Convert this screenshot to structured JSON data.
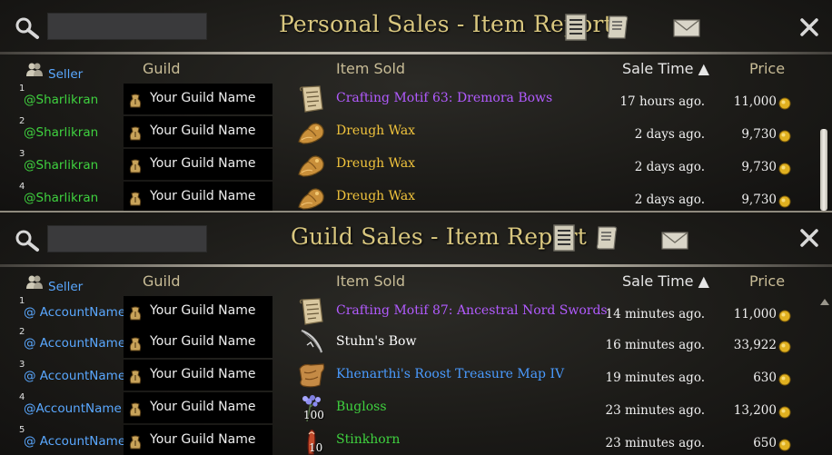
{
  "personal": {
    "title": "Personal Sales - Item Report",
    "search": {
      "placeholder": ""
    },
    "headers": {
      "seller": "Seller",
      "guild": "Guild",
      "item": "Item Sold",
      "time": "Sale Time ▲",
      "price": "Price"
    },
    "rows": [
      {
        "num": "1",
        "seller": "@Sharlikran",
        "guild": "Your Guild Name",
        "item": "Crafting Motif 63: Dremora Bows",
        "item_color": "#b25bff",
        "icon": "scroll-icon",
        "time": "17 hours ago.",
        "price": "11,000",
        "qty": ""
      },
      {
        "num": "2",
        "seller": "@Sharlikran",
        "guild": "Your Guild Name",
        "item": "Dreugh Wax",
        "item_color": "#f0c33c",
        "icon": "dreugh-wax-icon",
        "time": "2 days ago.",
        "price": "9,730",
        "qty": ""
      },
      {
        "num": "3",
        "seller": "@Sharlikran",
        "guild": "Your Guild Name",
        "item": "Dreugh Wax",
        "item_color": "#f0c33c",
        "icon": "dreugh-wax-icon",
        "time": "2 days ago.",
        "price": "9,730",
        "qty": ""
      },
      {
        "num": "4",
        "seller": "@Sharlikran",
        "guild": "Your Guild Name",
        "item": "Dreugh Wax",
        "item_color": "#f0c33c",
        "icon": "dreugh-wax-icon",
        "time": "2 days ago.",
        "price": "9,730",
        "qty": ""
      }
    ]
  },
  "guild": {
    "title": "Guild Sales - Item Report",
    "search": {
      "placeholder": ""
    },
    "headers": {
      "seller": "Seller",
      "guild": "Guild",
      "item": "Item Sold",
      "time": "Sale Time ▲",
      "price": "Price"
    },
    "rows": [
      {
        "num": "1",
        "seller": "@ AccountName",
        "guild": "Your Guild Name",
        "item": "Crafting Motif 87: Ancestral Nord Swords",
        "item_color": "#b25bff",
        "icon": "scroll-icon",
        "time": "14 minutes ago.",
        "price": "11,000",
        "qty": ""
      },
      {
        "num": "2",
        "seller": "@ AccountName",
        "guild": "Your Guild Name",
        "item": "Stuhn's Bow",
        "item_color": "#ffffff",
        "icon": "bow-icon",
        "time": "16 minutes ago.",
        "price": "33,922",
        "qty": ""
      },
      {
        "num": "3",
        "seller": "@ AccountName",
        "guild": "Your Guild Name",
        "item": "Khenarthi's Roost Treasure Map IV",
        "item_color": "#4a9bff",
        "icon": "treasure-map-icon",
        "time": "19 minutes ago.",
        "price": "630",
        "qty": ""
      },
      {
        "num": "4",
        "seller": "@AccountName",
        "guild": "Your Guild Name",
        "item": "Bugloss",
        "item_color": "#3fd13f",
        "icon": "bugloss-icon",
        "time": "23 minutes ago.",
        "price": "13,200",
        "qty": "100"
      },
      {
        "num": "5",
        "seller": "@ AccountName",
        "guild": "Your Guild Name",
        "item": "Stinkhorn",
        "item_color": "#3fd13f",
        "icon": "stinkhorn-icon",
        "time": "23 minutes ago.",
        "price": "650",
        "qty": "10"
      }
    ]
  },
  "colors": {
    "title": "#d9c77f",
    "seller_header": "#5aa8ff",
    "seller_personal": "#3fd13f",
    "seller_guild": "#5aa8ff",
    "gold": "#e0b020"
  }
}
